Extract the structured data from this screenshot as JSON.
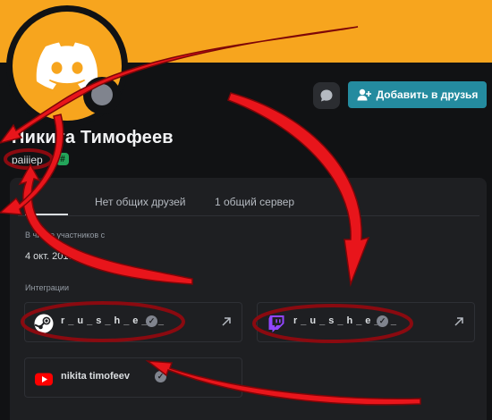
{
  "header": {
    "banner_color": "#f7a51e",
    "avatar_icon": "discord-logo-icon",
    "status_icon": "offline-status-icon"
  },
  "actions": {
    "message_icon": "chat-bubble-icon",
    "add_friend_label": "Добавить в друзья",
    "add_friend_icon": "add-user-icon",
    "accent_color": "#248b9f"
  },
  "profile": {
    "display_name": "Никита Тимофеев",
    "username": "раiiiер",
    "badge_symbol": "#",
    "badge_color": "#23a55a"
  },
  "tabs": [
    {
      "label": ""
    },
    {
      "label": "Нет общих друзей"
    },
    {
      "label": "1 общий сервер"
    }
  ],
  "about": {
    "member_since_label": "В числе участников с",
    "member_since_value": "4 окт. 2018 г.",
    "integrations_label": "Интеграции"
  },
  "integrations": [
    {
      "service": "steam",
      "icon": "steam-icon",
      "name": "r_u_s_h_e_r_",
      "verified": true
    },
    {
      "service": "twitch",
      "icon": "twitch-icon",
      "name": "r_u_s_h_e_r_",
      "verified": true
    },
    {
      "service": "youtube",
      "icon": "youtube-icon",
      "name": "nikita timofeev",
      "verified": true
    }
  ],
  "annotation_color": "#e8151b"
}
